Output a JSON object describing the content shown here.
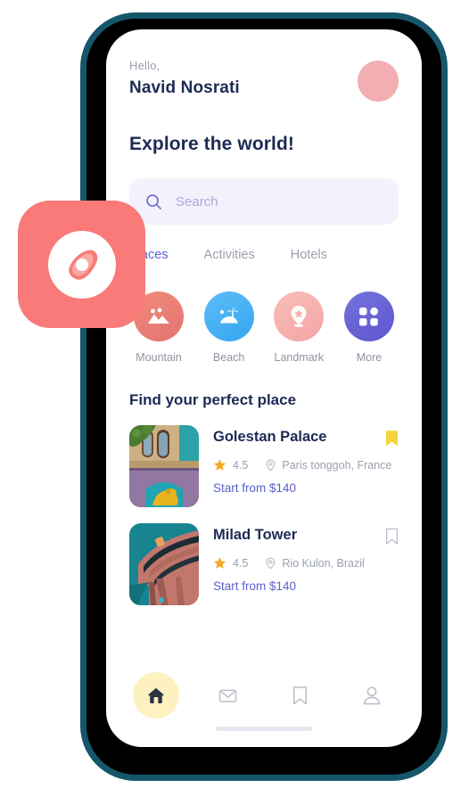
{
  "app_icon": {
    "icon": "compass-logo-icon",
    "bg_color": "#f97a78"
  },
  "phone": {
    "frame_color": "#16566b"
  },
  "header": {
    "greeting": "Hello,",
    "user_name": "Navid Nosrati",
    "avatar": {
      "icon": "avatar",
      "color": "#f2aeb0"
    }
  },
  "explore": {
    "title": "Explore the world!"
  },
  "search": {
    "placeholder": "Search",
    "value": "",
    "icon": "search-icon",
    "bg_color": "#f3f2fc"
  },
  "tabs": {
    "active_index": 0,
    "items": [
      {
        "label": "Places",
        "active": true
      },
      {
        "label": "Activities",
        "active": false
      },
      {
        "label": "Hotels",
        "active": false
      }
    ],
    "active_color": "#5a5fd0"
  },
  "categories": [
    {
      "label": "Mountain",
      "icon": "mountain-icon",
      "color_from": "#ef8577",
      "color_to": "#e87b7b"
    },
    {
      "label": "Beach",
      "icon": "beach-palm-icon",
      "color_from": "#57b9f5",
      "color_to": "#3aa8f0"
    },
    {
      "label": "Landmark",
      "icon": "landmark-pin-icon",
      "color_from": "#f7b9b5",
      "color_to": "#f4aaa8"
    },
    {
      "label": "More",
      "icon": "grid-more-icon",
      "color_from": "#6f6fd8",
      "color_to": "#6059d0"
    }
  ],
  "listings": {
    "section_title": "Find your perfect place",
    "items": [
      {
        "title": "Golestan Palace",
        "rating": "4.5",
        "location": "Paris tonggoh, France",
        "price": "Start from $140",
        "bookmarked": true,
        "thumb": "golestan-palace-photo"
      },
      {
        "title": "Milad Tower",
        "rating": "4.5",
        "location": "Rio Kulon, Brazil",
        "price": "Start from $140",
        "bookmarked": false,
        "thumb": "milad-tower-photo"
      }
    ],
    "star_color": "#f5a623",
    "price_color": "#5a5fd0",
    "bookmark_active_color": "#f5d33a"
  },
  "bottom_nav": {
    "active_index": 0,
    "items": [
      {
        "name": "home",
        "icon": "home-icon",
        "active": true
      },
      {
        "name": "messages",
        "icon": "mail-icon",
        "active": false
      },
      {
        "name": "saved",
        "icon": "bookmark-icon",
        "active": false
      },
      {
        "name": "profile",
        "icon": "person-icon",
        "active": false
      }
    ],
    "active_bg": "#fdf1c0"
  }
}
